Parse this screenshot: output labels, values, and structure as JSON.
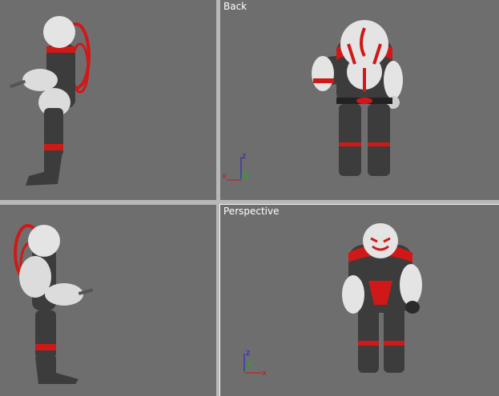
{
  "viewports": {
    "top_left": {
      "label": "",
      "view": "right-side"
    },
    "top_right": {
      "label": "Back",
      "view": "back"
    },
    "bottom_left": {
      "label": "",
      "view": "left-side"
    },
    "bottom_right": {
      "label": "Perspective",
      "view": "perspective"
    }
  },
  "axis": {
    "x": "x",
    "y": "y",
    "z": "z"
  },
  "colors": {
    "viewport_bg": "#6e6e6e",
    "frame": "#b8b8b8",
    "suit_dark": "#3c3c3c",
    "head_white": "#e4e4e4",
    "accent_red": "#d01818",
    "axis_x": "#c81818",
    "axis_y": "#20b020",
    "axis_z": "#2020c8"
  }
}
